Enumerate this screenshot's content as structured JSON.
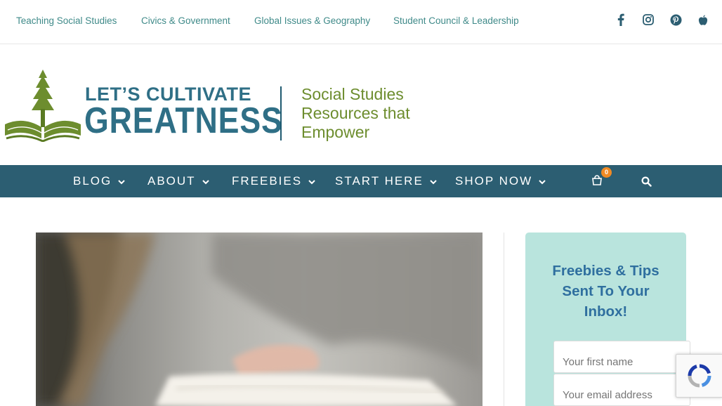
{
  "topbar": {
    "links": [
      {
        "label": "Teaching Social Studies"
      },
      {
        "label": "Civics & Government"
      },
      {
        "label": "Global Issues & Geography"
      },
      {
        "label": "Student Council & Leadership"
      }
    ],
    "social_icons": [
      "facebook-icon",
      "instagram-icon",
      "pinterest-icon",
      "apple-icon"
    ]
  },
  "logo": {
    "line1": "LET’S CULTIVATE",
    "line2": "GREATNESS",
    "tagline": [
      "Social Studies",
      "Resources that",
      "Empower"
    ]
  },
  "nav": {
    "items": [
      {
        "label": "BLOG"
      },
      {
        "label": "ABOUT"
      },
      {
        "label": "FREEBIES"
      },
      {
        "label": "START HERE"
      },
      {
        "label": "SHOP NOW"
      }
    ],
    "cart_count": "0",
    "icons": [
      "cart-icon",
      "search-icon"
    ]
  },
  "sidebar": {
    "optin_title": "Freebies & Tips Sent To Your Inbox!",
    "first_name_placeholder": "Your first name",
    "email_placeholder": "Your email address"
  },
  "colors": {
    "link_teal": "#3f8a89",
    "nav_bg": "#2c5e72",
    "logo_blue": "#2f6f86",
    "tagline_green": "#6d8d2e",
    "optin_bg": "#b9e4dd",
    "optin_title": "#2f6f9f",
    "cart_badge": "#f08a24"
  }
}
